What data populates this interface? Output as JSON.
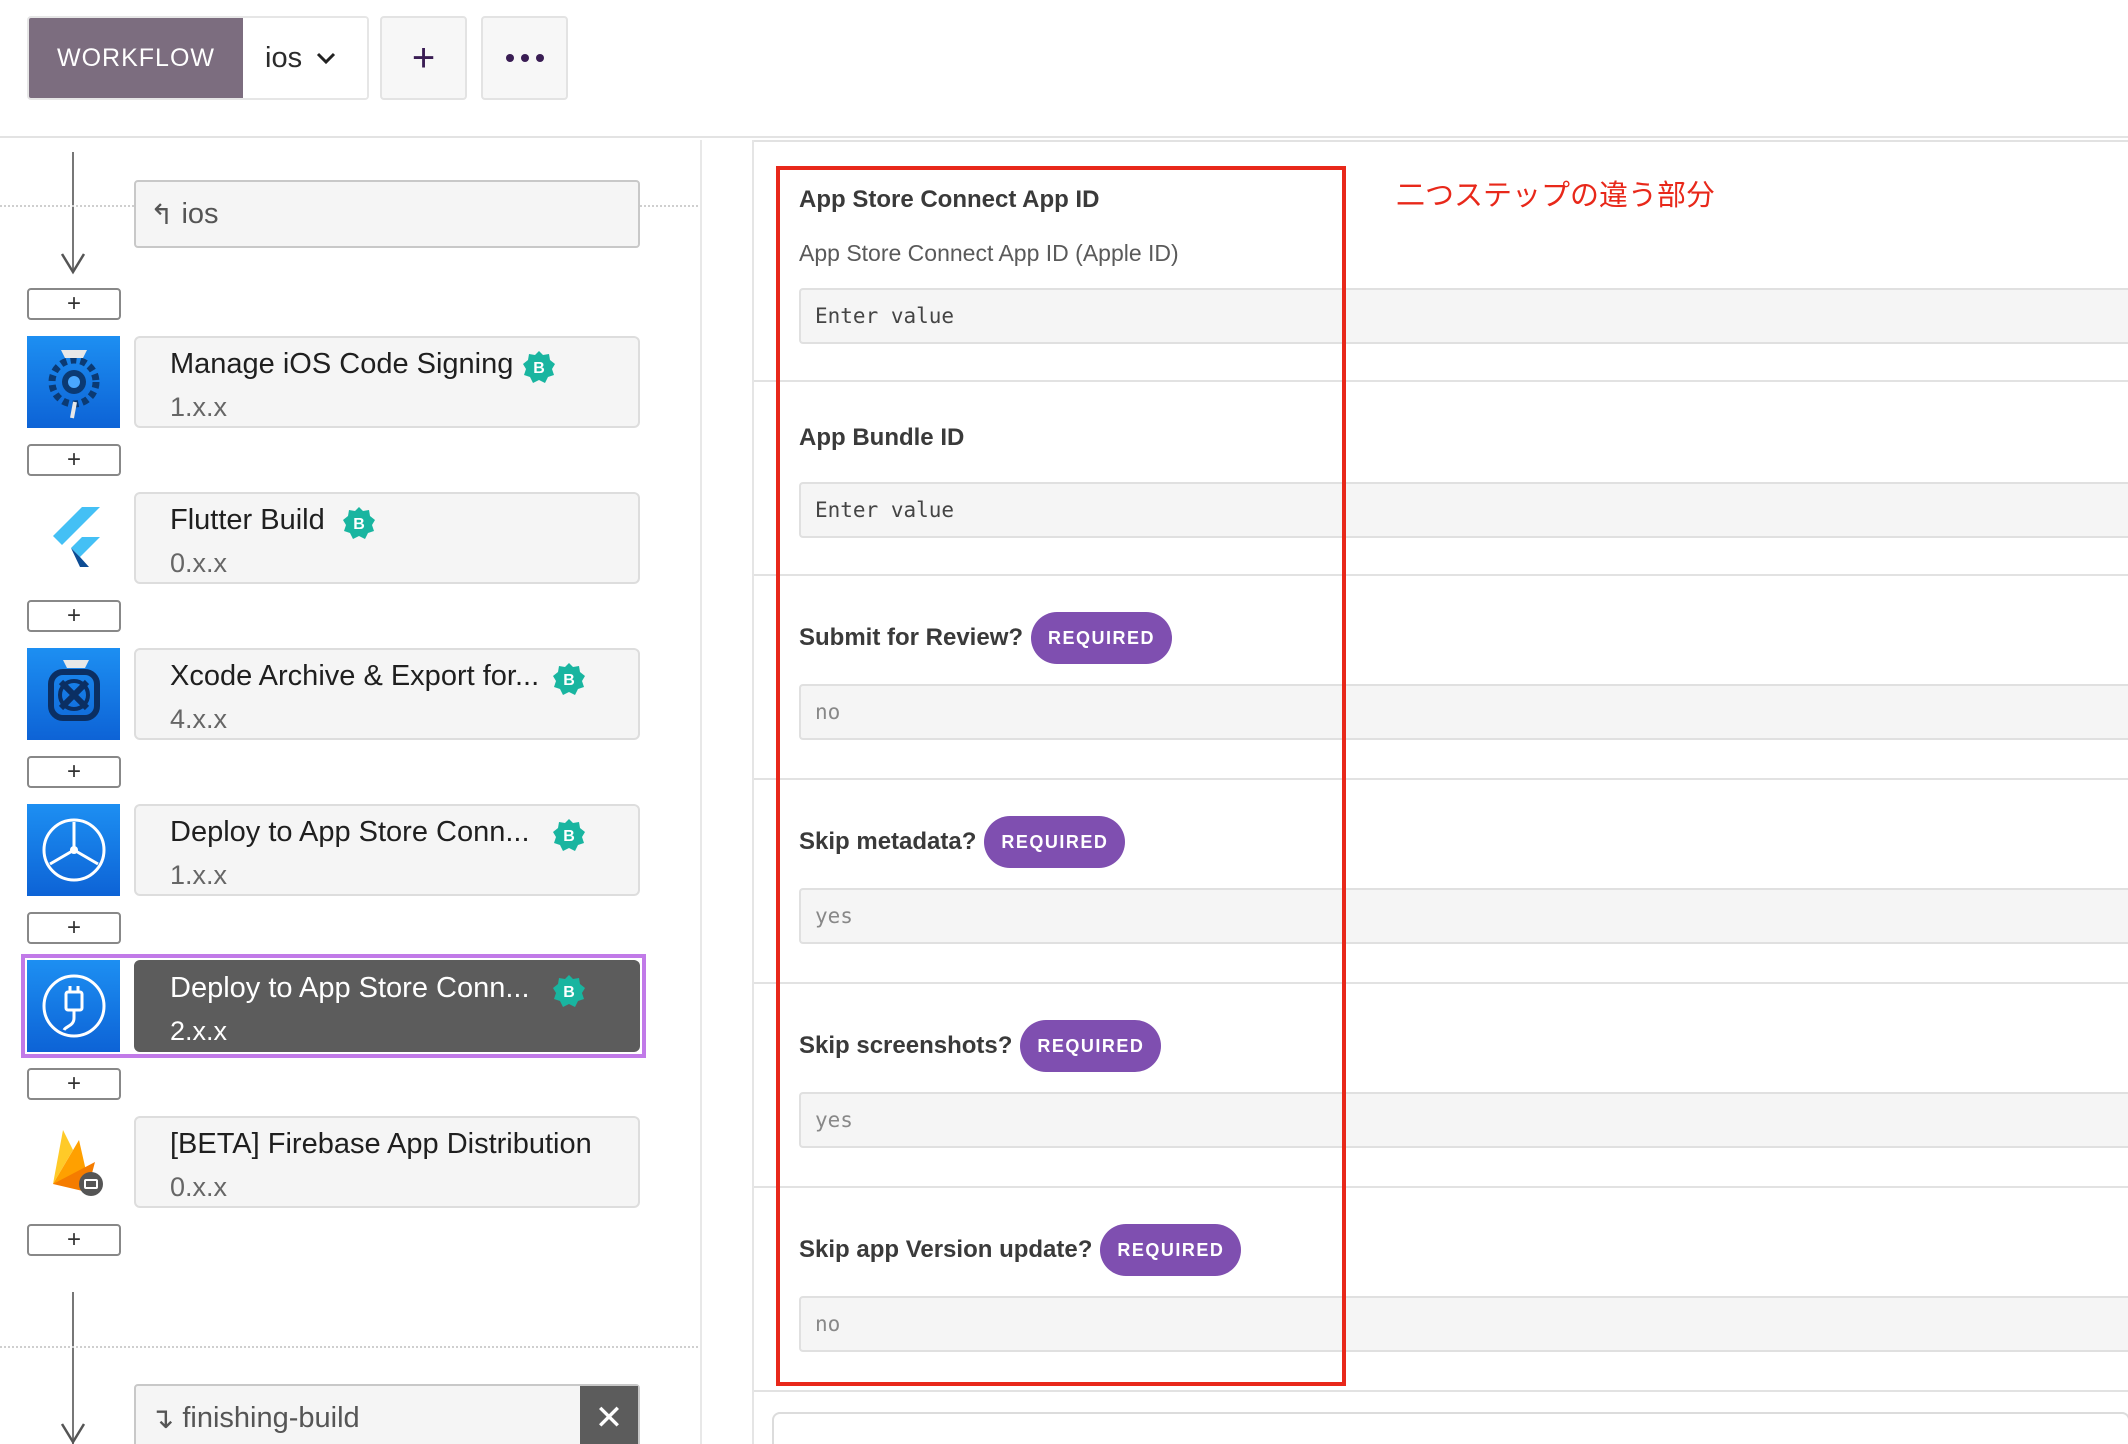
{
  "toolbar": {
    "workflow_label": "WORKFLOW",
    "selected_workflow": "ios",
    "add_label": "+",
    "more_label": "•••"
  },
  "workflow": {
    "trigger_workflow": "ios",
    "add_step_label": "+",
    "steps": [
      {
        "title": "Manage iOS Code Signing",
        "version": "1.x.x",
        "badge": "B",
        "icon": "code-signing-icon"
      },
      {
        "title": "Flutter Build",
        "version": "0.x.x",
        "badge": "B",
        "icon": "flutter-icon"
      },
      {
        "title": "Xcode Archive & Export for...",
        "version": "4.x.x",
        "badge": "B",
        "icon": "xcode-icon"
      },
      {
        "title": "Deploy to App Store Conn...",
        "version": "1.x.x",
        "badge": "B",
        "icon": "app-store-icon"
      },
      {
        "title": "Deploy to App Store Conn...",
        "version": "2.x.x",
        "badge": "B",
        "icon": "app-store-plug-icon",
        "selected": true
      },
      {
        "title": "[BETA] Firebase App Distribution",
        "version": "0.x.x",
        "badge": "",
        "icon": "firebase-icon"
      }
    ],
    "after_workflow": "finishing-build",
    "remove_label": "✕"
  },
  "form": {
    "fields": [
      {
        "label": "App Store Connect App ID",
        "description": "App Store Connect App ID (Apple ID)",
        "value": "Enter value",
        "required": false
      },
      {
        "label": "App Bundle ID",
        "value": "Enter value",
        "required": false
      },
      {
        "label": "Submit for Review?",
        "value": "no",
        "required": true
      },
      {
        "label": "Skip metadata?",
        "value": "yes",
        "required": true
      },
      {
        "label": "Skip screenshots?",
        "value": "yes",
        "required": true
      },
      {
        "label": "Skip app Version update?",
        "value": "no",
        "required": true
      }
    ],
    "required_label": "REQUIRED"
  },
  "annotation": {
    "text": "二つステップの違う部分",
    "color": "#e8281a"
  },
  "colors": {
    "workflow_label_bg": "#7c6d7f",
    "required_badge": "#7f4fb0",
    "step_badge": "#19b5a0",
    "selected_step_outline": "#c17ae8",
    "selected_step_bg": "#5c5c5c"
  }
}
